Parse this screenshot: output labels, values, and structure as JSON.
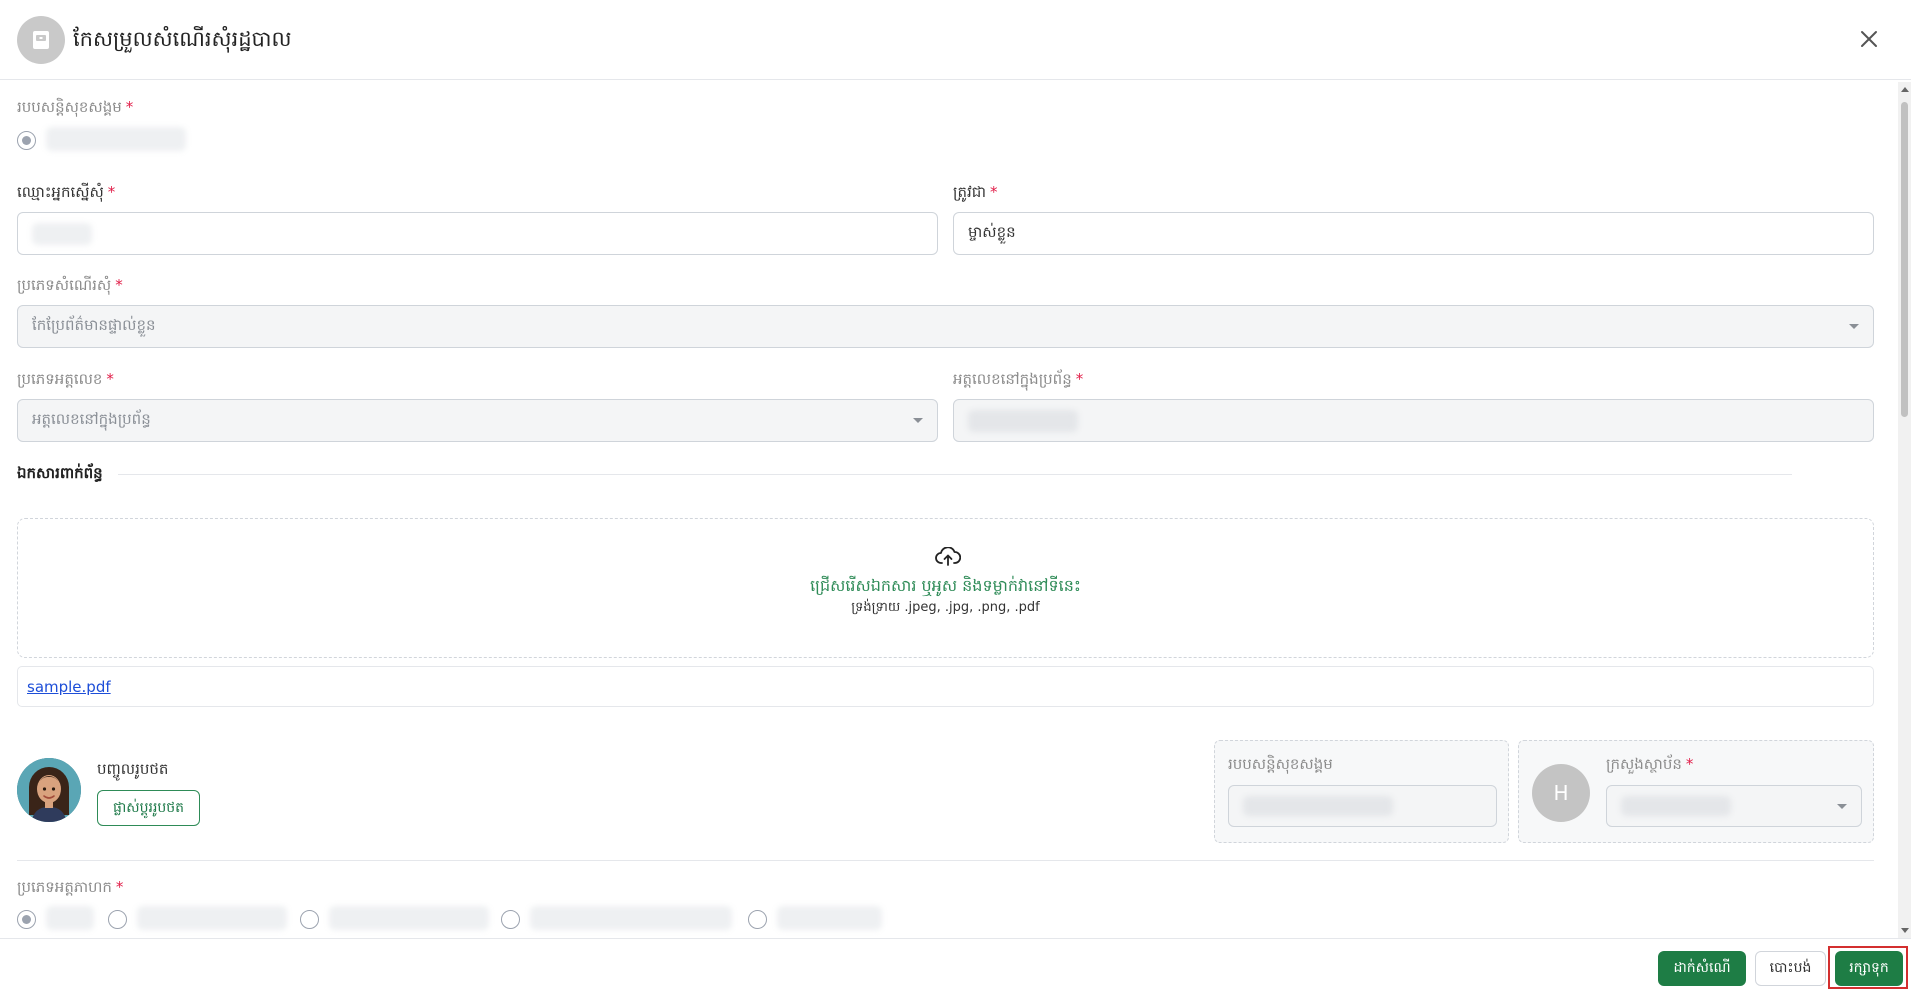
{
  "header": {
    "title": "កែសម្រួលសំណើរសុំរដ្ឋបាល"
  },
  "form": {
    "social_security": {
      "label": "របបសន្តិសុខសង្គម"
    },
    "applicant_name": {
      "label": "ឈ្មោះអ្នកស្នើសុំ",
      "value": ""
    },
    "relation": {
      "label": "ត្រូវជា",
      "value": "ម្ចាស់ខ្លួន"
    },
    "request_type": {
      "label": "ប្រភេទសំណើរសុំ",
      "value": "កែប្រែព័ត៌មានផ្ទាល់ខ្លួន"
    },
    "id_type": {
      "label": "ប្រភេទអត្តលេខ",
      "value": "អត្តលេខនៅក្នុងប្រព័ន្ធ"
    },
    "id_number": {
      "label": "អត្តលេខនៅក្នុងប្រព័ន្ធ",
      "value": ""
    }
  },
  "attachments": {
    "title": "ឯកសារពាក់ព័ន្ធ",
    "drop_text": "ជ្រើសរើសឯកសារ ឬអូស និងទម្លាក់វានៅទីនេះ",
    "formats_text": "ទ្រង់ទ្រាយ .jpeg, .jpg, .png, .pdf",
    "files": [
      "sample.pdf"
    ]
  },
  "photo": {
    "label": "បញ្ចូលរូបថត",
    "change_button": "ផ្លាស់ប្តូររូបថត"
  },
  "social_card": {
    "label": "របបសន្តិសុខសង្គម"
  },
  "ministry_card": {
    "avatar_letter": "H",
    "label": "ក្រសួងស្ថាប័ន"
  },
  "employee_type": {
    "label": "ប្រភេទអត្តភាហក"
  },
  "footer": {
    "submit_label": "ដាក់សំណើ",
    "cancel_label": "បោះបង់",
    "save_label": "រក្សាទុក"
  },
  "colors": {
    "primary": "#1e7d45",
    "required": "#e11d48",
    "link": "#1d4ed8"
  }
}
